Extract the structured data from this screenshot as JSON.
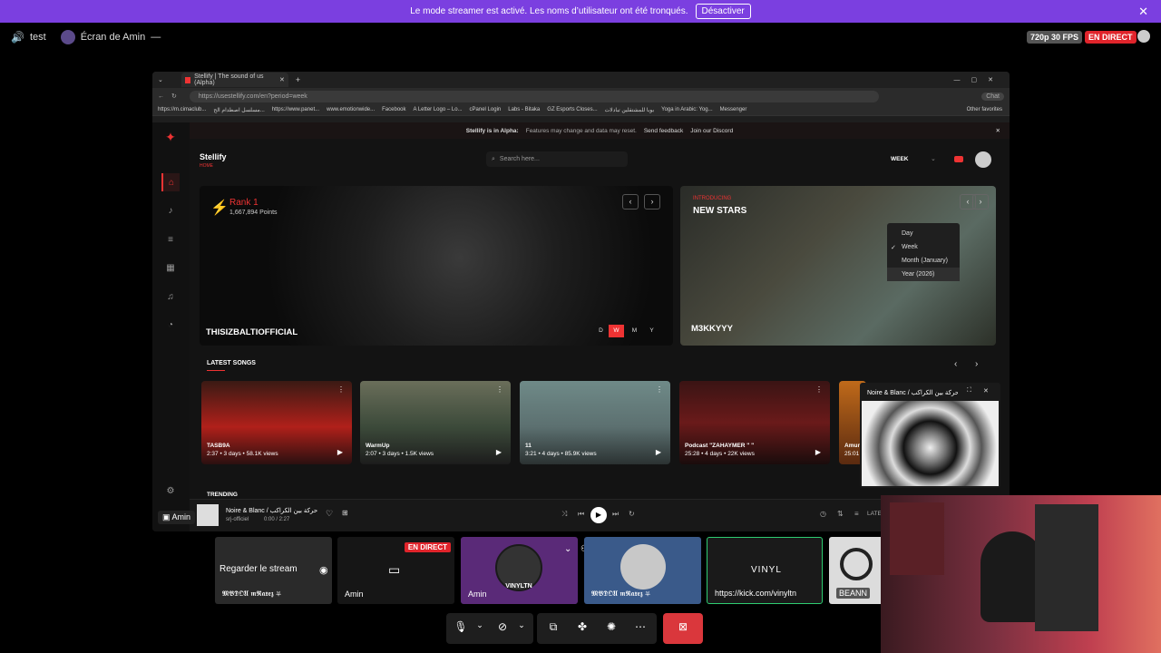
{
  "notice": {
    "text": "Le mode streamer est activé. Les noms d’utilisateur ont été tronqués.",
    "button": "Désactiver"
  },
  "discord_bar": {
    "channel": "test",
    "stream_title": "Écran de Amin",
    "quality": "720p 30 FPS",
    "live": "EN DIRECT"
  },
  "browser": {
    "tab_title": "Stellify | The sound of us (Alpha)",
    "url": "https://usestellify.com/en?period=week",
    "chat_label": "Chat",
    "bookmarks": [
      "https://m.cimaclub...",
      "مسلسل اصطدام الح...",
      "https://www.panet...",
      "www.emotionwide...",
      "Facebook",
      "A Letter Logo – Lo...",
      "cPanel Login",
      "Labs - Bitaka",
      "GZ Esports Closes...",
      "بوبا للمشتقلين تبادلات",
      "Yoga in Arabic: Yog...",
      "Messenger"
    ],
    "other_favorites": "Other favorites"
  },
  "app": {
    "alpha_text": "Stellify is in Alpha:",
    "alpha_sub": "Features may change and data may reset.",
    "send_feedback": "Send feedback",
    "join_discord": "Join our Discord",
    "brand": "Stellify",
    "brand_sub": "HOME",
    "search_placeholder": "Search here...",
    "period": "WEEK",
    "period_menu": [
      "Day",
      "Week",
      "Month (January)",
      "Year (2026)"
    ],
    "hero": {
      "rank": "Rank 1",
      "points": "1,667,894 Points",
      "artist": "THISIZBALTIOFFICIAL",
      "tabs": [
        "D",
        "W",
        "M",
        "Y"
      ]
    },
    "new_stars": {
      "intro": "INTRODUCING",
      "title": "NEW STARS",
      "artist": "M3KKYYY"
    },
    "latest_songs_title": "LATEST SONGS",
    "songs": [
      {
        "title": "TASB9A",
        "meta": "2:37 • 3 days • 58.1K views"
      },
      {
        "title": "WarmUp",
        "meta": "2:07 • 3 days • 1.5K views"
      },
      {
        "title": "11",
        "meta": "3:21 • 4 days • 85.9K views"
      },
      {
        "title": "Podcast \"ZAHAYMER \" \"",
        "meta": "25:28 • 4 days • 22K views"
      },
      {
        "title": "Amun",
        "meta": "25:01"
      }
    ],
    "trending_title": "TRENDING",
    "player": {
      "title": "Noire & Blanc / حركة بين الكراكب",
      "artist": "srj-officiel",
      "time": "0:00 / 2:27",
      "late": "LATE"
    },
    "mini_player_title": "Noire & Blanc / حركة بين الكراكب"
  },
  "overlay_user": "Amin",
  "tiles": [
    {
      "label": "Regarder le stream",
      "user": "𝕸𝕭𝕯𝕺𝖀 𝖒𝕽𝖆𝖝𝖊𝖟 ⛧"
    },
    {
      "user": "Amin",
      "badge": "EN DIRECT"
    },
    {
      "user": "Amin",
      "avatar_text": "VINYLTN"
    },
    {
      "user": "𝕸𝕭𝕯𝕺𝖀 𝖒𝕽𝖆𝖝𝖊𝖟 ⛧"
    },
    {
      "title": "VINYL",
      "link": "https://kick.com/vinyltn"
    },
    {
      "user": "BEANN"
    }
  ]
}
